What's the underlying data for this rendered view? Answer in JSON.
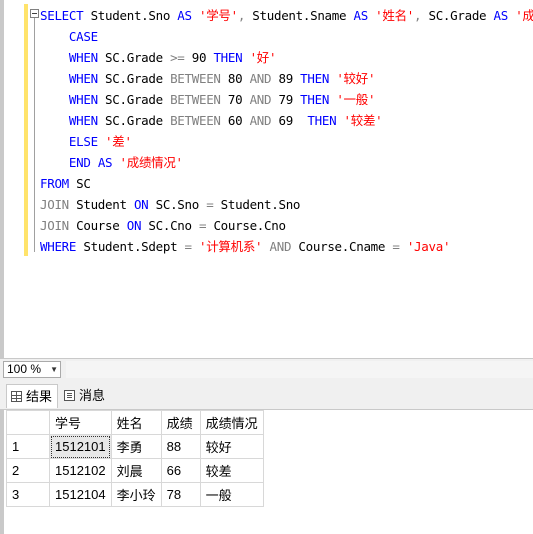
{
  "editor": {
    "lines": [
      [
        {
          "t": "SELECT",
          "c": "kw"
        },
        {
          "t": " Student.Sno ",
          "c": ""
        },
        {
          "t": "AS",
          "c": "kw"
        },
        {
          "t": " ",
          "c": ""
        },
        {
          "t": "'学号'",
          "c": "str"
        },
        {
          "t": ", ",
          "c": "op"
        },
        {
          "t": "Student.Sname ",
          "c": ""
        },
        {
          "t": "AS",
          "c": "kw"
        },
        {
          "t": " ",
          "c": ""
        },
        {
          "t": "'姓名'",
          "c": "str"
        },
        {
          "t": ", ",
          "c": "op"
        },
        {
          "t": "SC.Grade ",
          "c": ""
        },
        {
          "t": "AS",
          "c": "kw"
        },
        {
          "t": " ",
          "c": ""
        },
        {
          "t": "'成绩'",
          "c": "str"
        },
        {
          "t": ",",
          "c": "op"
        }
      ],
      [
        {
          "t": "    CASE",
          "c": "kw"
        }
      ],
      [
        {
          "t": "    WHEN",
          "c": "kw"
        },
        {
          "t": " SC.Grade ",
          "c": ""
        },
        {
          "t": ">=",
          "c": "op"
        },
        {
          "t": " 90 ",
          "c": ""
        },
        {
          "t": "THEN",
          "c": "kw"
        },
        {
          "t": " ",
          "c": ""
        },
        {
          "t": "'好'",
          "c": "str"
        }
      ],
      [
        {
          "t": "    WHEN",
          "c": "kw"
        },
        {
          "t": " SC.Grade ",
          "c": ""
        },
        {
          "t": "BETWEEN",
          "c": "op"
        },
        {
          "t": " 80 ",
          "c": ""
        },
        {
          "t": "AND",
          "c": "op"
        },
        {
          "t": " 89 ",
          "c": ""
        },
        {
          "t": "THEN",
          "c": "kw"
        },
        {
          "t": " ",
          "c": ""
        },
        {
          "t": "'较好'",
          "c": "str"
        }
      ],
      [
        {
          "t": "    WHEN",
          "c": "kw"
        },
        {
          "t": " SC.Grade ",
          "c": ""
        },
        {
          "t": "BETWEEN",
          "c": "op"
        },
        {
          "t": " 70 ",
          "c": ""
        },
        {
          "t": "AND",
          "c": "op"
        },
        {
          "t": " 79 ",
          "c": ""
        },
        {
          "t": "THEN",
          "c": "kw"
        },
        {
          "t": " ",
          "c": ""
        },
        {
          "t": "'一般'",
          "c": "str"
        }
      ],
      [
        {
          "t": "    WHEN",
          "c": "kw"
        },
        {
          "t": " SC.Grade ",
          "c": ""
        },
        {
          "t": "BETWEEN",
          "c": "op"
        },
        {
          "t": " 60 ",
          "c": ""
        },
        {
          "t": "AND",
          "c": "op"
        },
        {
          "t": " 69  ",
          "c": ""
        },
        {
          "t": "THEN",
          "c": "kw"
        },
        {
          "t": " ",
          "c": ""
        },
        {
          "t": "'较差'",
          "c": "str"
        }
      ],
      [
        {
          "t": "    ELSE",
          "c": "kw"
        },
        {
          "t": " ",
          "c": ""
        },
        {
          "t": "'差'",
          "c": "str"
        }
      ],
      [
        {
          "t": "    END",
          "c": "kw"
        },
        {
          "t": " ",
          "c": ""
        },
        {
          "t": "AS",
          "c": "kw"
        },
        {
          "t": " ",
          "c": ""
        },
        {
          "t": "'成绩情况'",
          "c": "str"
        }
      ],
      [
        {
          "t": "FROM",
          "c": "kw"
        },
        {
          "t": " SC",
          "c": ""
        }
      ],
      [
        {
          "t": "JOIN",
          "c": "op"
        },
        {
          "t": " Student ",
          "c": ""
        },
        {
          "t": "ON",
          "c": "kw"
        },
        {
          "t": " SC.Sno ",
          "c": ""
        },
        {
          "t": "=",
          "c": "op"
        },
        {
          "t": " Student.Sno",
          "c": ""
        }
      ],
      [
        {
          "t": "JOIN",
          "c": "op"
        },
        {
          "t": " Course ",
          "c": ""
        },
        {
          "t": "ON",
          "c": "kw"
        },
        {
          "t": " SC.Cno ",
          "c": ""
        },
        {
          "t": "=",
          "c": "op"
        },
        {
          "t": " Course.Cno",
          "c": ""
        }
      ],
      [
        {
          "t": "WHERE",
          "c": "kw"
        },
        {
          "t": " Student.Sdept ",
          "c": ""
        },
        {
          "t": "=",
          "c": "op"
        },
        {
          "t": " ",
          "c": ""
        },
        {
          "t": "'计算机系'",
          "c": "str"
        },
        {
          "t": " ",
          "c": ""
        },
        {
          "t": "AND",
          "c": "op"
        },
        {
          "t": " Course.Cname ",
          "c": ""
        },
        {
          "t": "=",
          "c": "op"
        },
        {
          "t": " ",
          "c": ""
        },
        {
          "t": "'Java'",
          "c": "str"
        }
      ]
    ]
  },
  "zoom": {
    "value": "100 %"
  },
  "tabs": {
    "results": "结果",
    "messages": "消息"
  },
  "grid": {
    "headers": [
      "学号",
      "姓名",
      "成绩",
      "成绩情况"
    ],
    "rows": [
      {
        "num": "1",
        "cells": [
          "1512101",
          "李勇",
          "88",
          "较好"
        ]
      },
      {
        "num": "2",
        "cells": [
          "1512102",
          "刘晨",
          "66",
          "较差"
        ]
      },
      {
        "num": "3",
        "cells": [
          "1512104",
          "李小玲",
          "78",
          "一般"
        ]
      }
    ]
  }
}
